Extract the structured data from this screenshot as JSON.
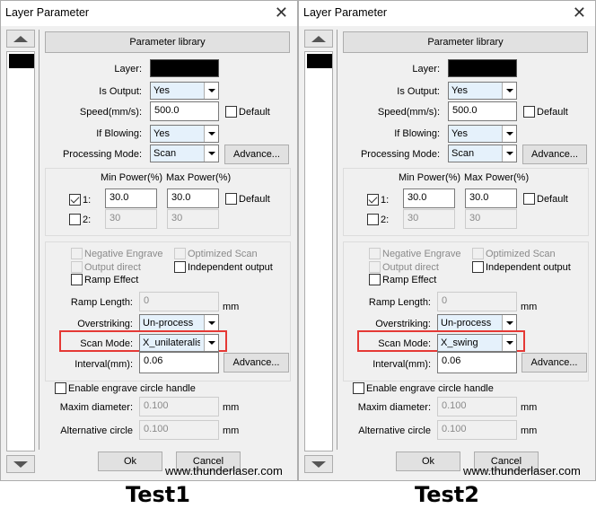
{
  "panels": [
    {
      "title": "Layer Parameter",
      "parameter_library": "Parameter library",
      "layer_label": "Layer:",
      "layer_color": "#000000",
      "is_output": {
        "label": "Is Output:",
        "value": "Yes"
      },
      "speed": {
        "label": "Speed(mm/s):",
        "value": "500.0",
        "default_label": "Default",
        "default_checked": false
      },
      "if_blowing": {
        "label": "If Blowing:",
        "value": "Yes"
      },
      "processing_mode": {
        "label": "Processing Mode:",
        "value": "Scan",
        "advance_label": "Advance..."
      },
      "power": {
        "min_header": "Min Power(%)",
        "max_header": "Max Power(%)",
        "default_label": "Default",
        "rows": [
          {
            "label": "1:",
            "checked": true,
            "min": "30.0",
            "max": "30.0",
            "enabled": true
          },
          {
            "label": "2:",
            "checked": false,
            "min": "30",
            "max": "30",
            "enabled": false
          }
        ]
      },
      "options": {
        "negative_engrave": "Negative Engrave",
        "optimized_scan": "Optimized Scan",
        "output_direct": "Output direct",
        "independent_output": "Independent output",
        "ramp_effect": "Ramp Effect"
      },
      "ramp_length": {
        "label": "Ramp Length:",
        "value": "0",
        "unit": "mm"
      },
      "overstriking": {
        "label": "Overstriking:",
        "value": "Un-process"
      },
      "scan_mode": {
        "label": "Scan Mode:",
        "value": "X_unilateralism"
      },
      "interval": {
        "label": "Interval(mm):",
        "value": "0.06",
        "advance_label": "Advance..."
      },
      "circle": {
        "enable_label": "Enable engrave circle handle",
        "max_diameter": {
          "label": "Maxim diameter:",
          "value": "0.100",
          "unit": "mm"
        },
        "alternative": {
          "label": "Alternative circle",
          "value": "0.100",
          "unit": "mm"
        }
      },
      "ok_label": "Ok",
      "cancel_label": "Cancel",
      "watermark": "www.thunderlaser.com",
      "caption": "Test1"
    },
    {
      "title": "Layer Parameter",
      "parameter_library": "Parameter library",
      "layer_label": "Layer:",
      "layer_color": "#000000",
      "is_output": {
        "label": "Is Output:",
        "value": "Yes"
      },
      "speed": {
        "label": "Speed(mm/s):",
        "value": "500.0",
        "default_label": "Default",
        "default_checked": false
      },
      "if_blowing": {
        "label": "If Blowing:",
        "value": "Yes"
      },
      "processing_mode": {
        "label": "Processing Mode:",
        "value": "Scan",
        "advance_label": "Advance..."
      },
      "power": {
        "min_header": "Min Power(%)",
        "max_header": "Max Power(%)",
        "default_label": "Default",
        "rows": [
          {
            "label": "1:",
            "checked": true,
            "min": "30.0",
            "max": "30.0",
            "enabled": true
          },
          {
            "label": "2:",
            "checked": false,
            "min": "30",
            "max": "30",
            "enabled": false
          }
        ]
      },
      "options": {
        "negative_engrave": "Negative Engrave",
        "optimized_scan": "Optimized Scan",
        "output_direct": "Output direct",
        "independent_output": "Independent output",
        "ramp_effect": "Ramp Effect"
      },
      "ramp_length": {
        "label": "Ramp Length:",
        "value": "0",
        "unit": "mm"
      },
      "overstriking": {
        "label": "Overstriking:",
        "value": "Un-process"
      },
      "scan_mode": {
        "label": "Scan Mode:",
        "value": "X_swing"
      },
      "interval": {
        "label": "Interval(mm):",
        "value": "0.06",
        "advance_label": "Advance..."
      },
      "circle": {
        "enable_label": "Enable engrave circle handle",
        "max_diameter": {
          "label": "Maxim diameter:",
          "value": "0.100",
          "unit": "mm"
        },
        "alternative": {
          "label": "Alternative circle",
          "value": "0.100",
          "unit": "mm"
        }
      },
      "ok_label": "Ok",
      "cancel_label": "Cancel",
      "watermark": "www.thunderlaser.com",
      "caption": "Test2"
    }
  ],
  "colors": {
    "highlight": "#e53935",
    "combo_bg": "#e5f1fb",
    "dialog_bg": "#f0f0f0"
  }
}
